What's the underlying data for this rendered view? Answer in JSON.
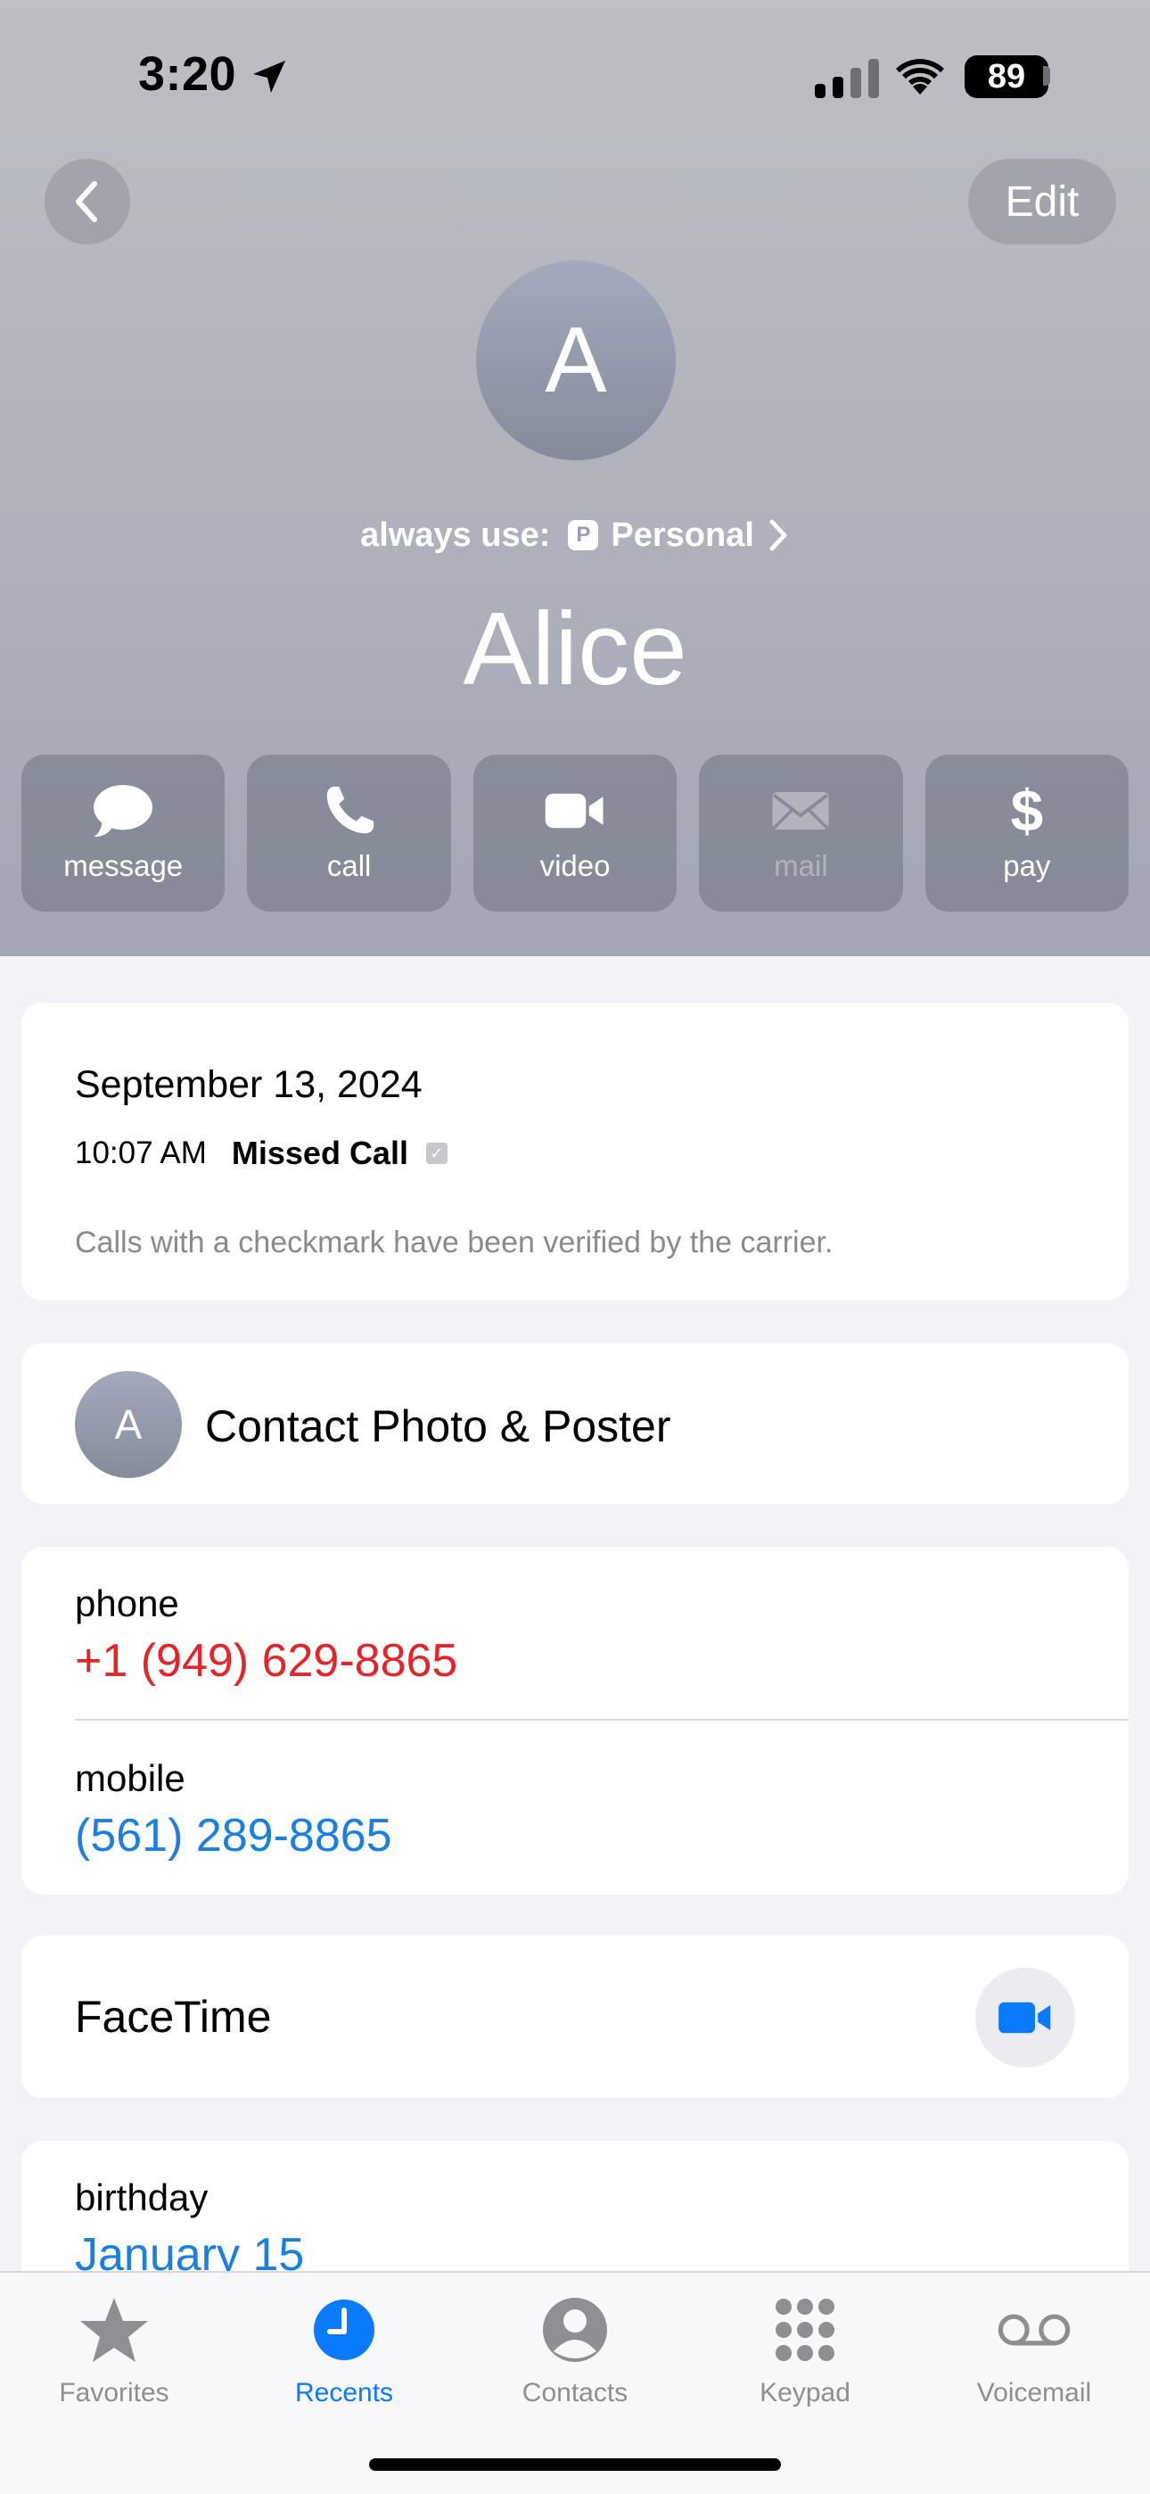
{
  "status_bar": {
    "time": "3:20",
    "battery": "89"
  },
  "header": {
    "edit_label": "Edit",
    "avatar_initial": "A",
    "always_use_label": "always use:",
    "line_badge": "P",
    "line_name": "Personal",
    "contact_name": "Alice"
  },
  "actions": [
    {
      "label": "message",
      "icon": "message-bubble-icon",
      "enabled": true
    },
    {
      "label": "call",
      "icon": "phone-icon",
      "enabled": true
    },
    {
      "label": "video",
      "icon": "video-camera-icon",
      "enabled": true
    },
    {
      "label": "mail",
      "icon": "envelope-icon",
      "enabled": false
    },
    {
      "label": "pay",
      "icon": "dollar-icon",
      "enabled": true
    }
  ],
  "call_info": {
    "date": "September 13, 2024",
    "time": "10:07 AM",
    "type": "Missed Call",
    "note": "Calls with a checkmark have been verified by the carrier."
  },
  "contact_photo": {
    "initial": "A",
    "label": "Contact Photo & Poster"
  },
  "phones": [
    {
      "label": "phone",
      "value": "+1 (949) 629-8865",
      "color": "#e5242a"
    },
    {
      "label": "mobile",
      "value": "(561) 289-8865",
      "color": "#1a7fe0"
    }
  ],
  "facetime": {
    "label": "FaceTime"
  },
  "birthday": {
    "label": "birthday",
    "value": "January 15"
  },
  "tabbar": [
    {
      "label": "Favorites",
      "icon": "star-icon",
      "active": false
    },
    {
      "label": "Recents",
      "icon": "clock-icon",
      "active": true
    },
    {
      "label": "Contacts",
      "icon": "person-circle-icon",
      "active": false
    },
    {
      "label": "Keypad",
      "icon": "keypad-icon",
      "active": false
    },
    {
      "label": "Voicemail",
      "icon": "voicemail-icon",
      "active": false
    }
  ],
  "colors": {
    "accent": "#0a7aff",
    "missed": "#e5242a",
    "link": "#1a7fe0"
  }
}
